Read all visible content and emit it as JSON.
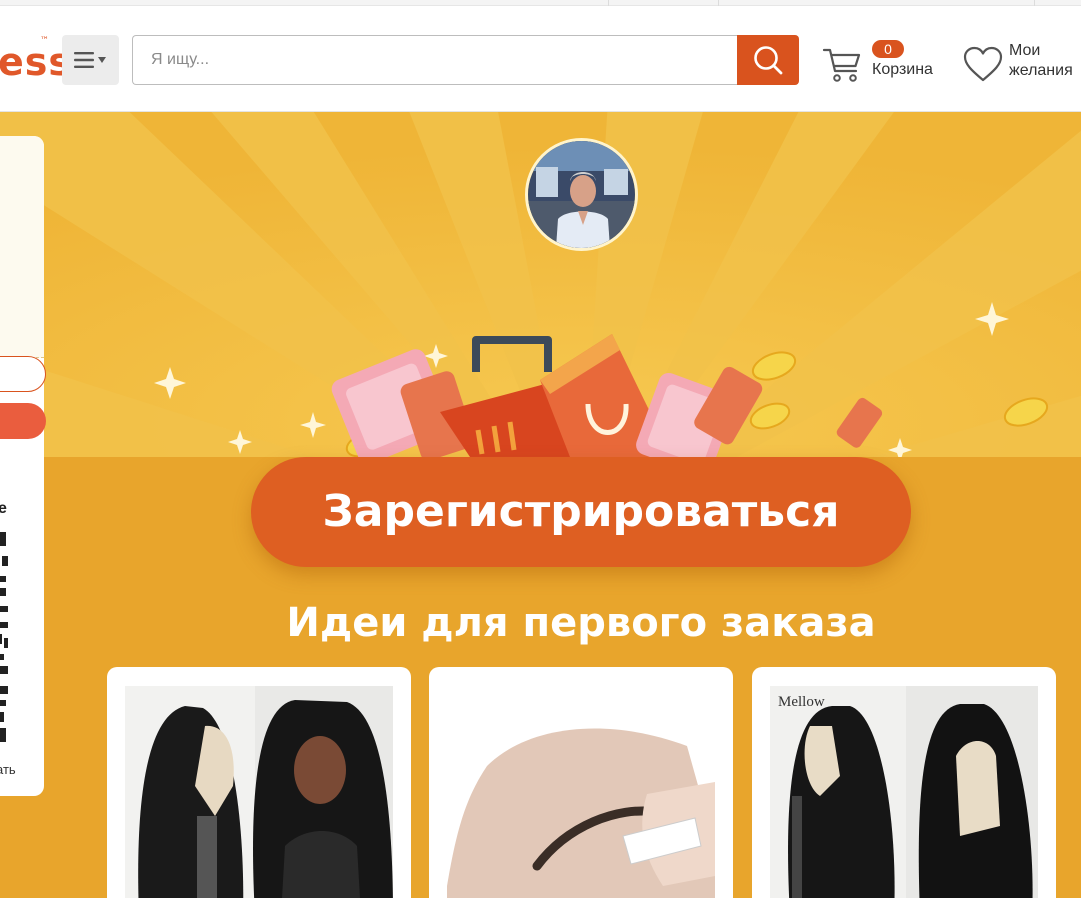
{
  "header": {
    "logo_text": "ess",
    "logo_tm": "™",
    "search_placeholder": "Я ищу...",
    "cart_count": "0",
    "cart_label": "Корзина",
    "wishlist_line1": "Мои",
    "wishlist_line2": "желания"
  },
  "banner": {
    "register_label": "Зарегистрироваться",
    "ideas_title": "Идеи для первого заказа",
    "product_cards": [
      {
        "image": "curly-wig-on-mannequin-and-model",
        "logo_text": ""
      },
      {
        "image": "eyebrow-transfer-sticker-on-hand",
        "logo_text": ""
      },
      {
        "image": "curly-wig-on-mannequin-heads",
        "logo_text": "Mellow"
      }
    ]
  },
  "side_panel": {
    "partial_heading": "e",
    "partial_footer": "ать"
  },
  "colors": {
    "accent": "#d9531e",
    "banner_bg": "#e8a52c",
    "register_button": "#de5f22"
  }
}
